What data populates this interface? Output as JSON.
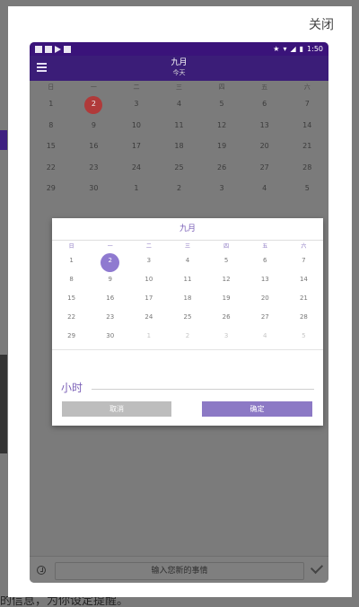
{
  "close_label": "关闭",
  "phone": {
    "status_time": "1:50",
    "month_title": "九月",
    "today_label": "今天",
    "weekdays": [
      "日",
      "一",
      "二",
      "三",
      "四",
      "五",
      "六"
    ],
    "background_calendar": [
      [
        {
          "d": "1",
          "l": ""
        },
        {
          "d": "2",
          "l": ""
        },
        {
          "d": "3",
          "l": ""
        },
        {
          "d": "4",
          "l": ""
        },
        {
          "d": "5",
          "l": ""
        },
        {
          "d": "6",
          "l": ""
        },
        {
          "d": "7",
          "l": ""
        }
      ],
      [
        {
          "d": "8",
          "l": ""
        },
        {
          "d": "9",
          "l": ""
        },
        {
          "d": "10",
          "l": ""
        },
        {
          "d": "11",
          "l": ""
        },
        {
          "d": "12",
          "l": ""
        },
        {
          "d": "13",
          "l": ""
        },
        {
          "d": "14",
          "l": ""
        }
      ],
      [
        {
          "d": "15",
          "l": ""
        },
        {
          "d": "16",
          "l": ""
        },
        {
          "d": "17",
          "l": ""
        },
        {
          "d": "18",
          "l": ""
        },
        {
          "d": "19",
          "l": ""
        },
        {
          "d": "20",
          "l": ""
        },
        {
          "d": "21",
          "l": ""
        }
      ],
      [
        {
          "d": "22",
          "l": ""
        },
        {
          "d": "23",
          "l": ""
        },
        {
          "d": "24",
          "l": ""
        },
        {
          "d": "25",
          "l": ""
        },
        {
          "d": "26",
          "l": ""
        },
        {
          "d": "27",
          "l": ""
        },
        {
          "d": "28",
          "l": ""
        }
      ],
      [
        {
          "d": "29",
          "l": ""
        },
        {
          "d": "30",
          "l": ""
        },
        {
          "d": "1",
          "l": ""
        },
        {
          "d": "2",
          "l": ""
        },
        {
          "d": "3",
          "l": ""
        },
        {
          "d": "4",
          "l": ""
        },
        {
          "d": "5",
          "l": ""
        }
      ]
    ],
    "background_selected": "2",
    "event_placeholder": "输入您新的事情"
  },
  "picker": {
    "title": "九月",
    "weekdays": [
      "日",
      "一",
      "二",
      "三",
      "四",
      "五",
      "六"
    ],
    "rows": [
      [
        {
          "d": "1",
          "l": ""
        },
        {
          "d": "2",
          "l": ""
        },
        {
          "d": "3",
          "l": ""
        },
        {
          "d": "4",
          "l": ""
        },
        {
          "d": "5",
          "l": ""
        },
        {
          "d": "6",
          "l": ""
        },
        {
          "d": "7",
          "l": ""
        }
      ],
      [
        {
          "d": "8",
          "l": ""
        },
        {
          "d": "9",
          "l": ""
        },
        {
          "d": "10",
          "l": ""
        },
        {
          "d": "11",
          "l": ""
        },
        {
          "d": "12",
          "l": ""
        },
        {
          "d": "13",
          "l": ""
        },
        {
          "d": "14",
          "l": ""
        }
      ],
      [
        {
          "d": "15",
          "l": ""
        },
        {
          "d": "16",
          "l": ""
        },
        {
          "d": "17",
          "l": ""
        },
        {
          "d": "18",
          "l": ""
        },
        {
          "d": "19",
          "l": ""
        },
        {
          "d": "20",
          "l": ""
        },
        {
          "d": "21",
          "l": ""
        }
      ],
      [
        {
          "d": "22",
          "l": ""
        },
        {
          "d": "23",
          "l": ""
        },
        {
          "d": "24",
          "l": ""
        },
        {
          "d": "25",
          "l": ""
        },
        {
          "d": "26",
          "l": ""
        },
        {
          "d": "27",
          "l": ""
        },
        {
          "d": "28",
          "l": ""
        }
      ],
      [
        {
          "d": "29",
          "l": ""
        },
        {
          "d": "30",
          "l": ""
        },
        {
          "d": "1",
          "l": "",
          "m": true
        },
        {
          "d": "2",
          "l": "",
          "m": true
        },
        {
          "d": "3",
          "l": "",
          "m": true
        },
        {
          "d": "4",
          "l": "",
          "m": true
        },
        {
          "d": "5",
          "l": "",
          "m": true
        }
      ]
    ],
    "selected": "2",
    "hour_label": "小时",
    "cancel_label": "取消",
    "ok_label": "确定"
  },
  "background_text": "的信息，为你设定提醒。"
}
